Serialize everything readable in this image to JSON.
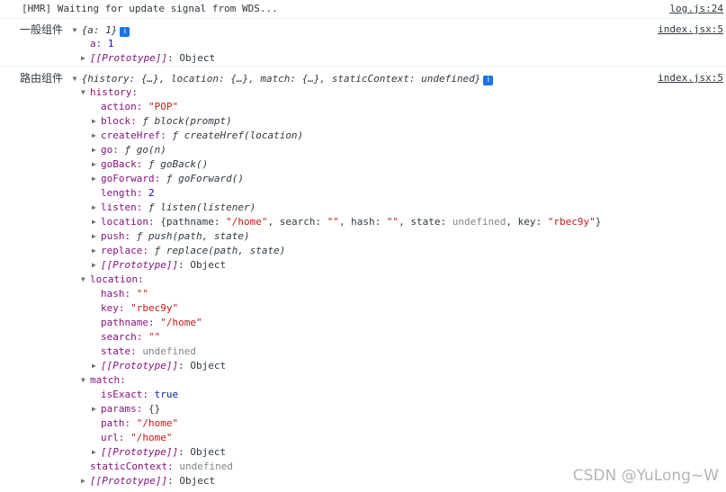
{
  "console": {
    "hmr_message": "[HMR] Waiting for update signal from WDS...",
    "hmr_source": "log.js:24",
    "messages": [
      {
        "label": "一般组件",
        "summary": "{a: 1}",
        "source": "index.jsx:5",
        "props": {
          "a_key": "a",
          "a_val": "1",
          "proto_key": "[[Prototype]]",
          "proto_val": "Object"
        }
      },
      {
        "label": "路由组件",
        "summary": "{history: {…}, location: {…}, match: {…}, staticContext: undefined}",
        "source": "index.jsx:5"
      }
    ]
  },
  "history": {
    "key": "history:",
    "action_key": "action:",
    "action_val": "\"POP\"",
    "block_key": "block:",
    "block_val": "ƒ block(prompt)",
    "createHref_key": "createHref:",
    "createHref_val": "ƒ createHref(location)",
    "go_key": "go:",
    "go_val": "ƒ go(n)",
    "goBack_key": "goBack:",
    "goBack_val": "ƒ goBack()",
    "goForward_key": "goForward:",
    "goForward_val": "ƒ goForward()",
    "length_key": "length:",
    "length_val": "2",
    "listen_key": "listen:",
    "listen_val": "ƒ listen(listener)",
    "location_key": "location:",
    "location_summary_open": "{pathname: ",
    "location_pathname": "\"/home\"",
    "location_search_k": ", search: ",
    "location_search": "\"\"",
    "location_hash_k": ", hash: ",
    "location_hash": "\"\"",
    "location_state_k": ", state: ",
    "location_state": "undefined",
    "location_key_k": ", key: ",
    "location_keyval": "\"rbec9y\"",
    "location_summary_close": "}",
    "push_key": "push:",
    "push_val": "ƒ push(path, state)",
    "replace_key": "replace:",
    "replace_val": "ƒ replace(path, state)",
    "proto_key": "[[Prototype]]",
    "proto_val": "Object"
  },
  "location": {
    "key": "location:",
    "hash_key": "hash:",
    "hash_val": "\"\"",
    "key_key": "key:",
    "key_val": "\"rbec9y\"",
    "pathname_key": "pathname:",
    "pathname_val": "\"/home\"",
    "search_key": "search:",
    "search_val": "\"\"",
    "state_key": "state:",
    "state_val": "undefined",
    "proto_key": "[[Prototype]]",
    "proto_val": "Object"
  },
  "match": {
    "key": "match:",
    "isExact_key": "isExact:",
    "isExact_val": "true",
    "params_key": "params:",
    "params_val": "{}",
    "path_key": "path:",
    "path_val": "\"/home\"",
    "url_key": "url:",
    "url_val": "\"/home\"",
    "proto_key": "[[Prototype]]",
    "proto_val": "Object"
  },
  "root_tail": {
    "staticContext_key": "staticContext:",
    "staticContext_val": "undefined",
    "proto_key": "[[Prototype]]",
    "proto_val": "Object"
  },
  "icons": {
    "expand": "triangle-right-icon",
    "collapse": "triangle-down-icon",
    "info": "info-icon"
  },
  "watermark": "CSDN @YuLong~W"
}
